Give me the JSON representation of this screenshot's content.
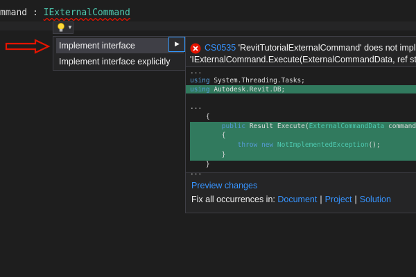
{
  "editor": {
    "code_prefix": "mmand : ",
    "interface_name": "IExternalCommand"
  },
  "quick_actions": {
    "items": [
      {
        "label": "Implement interface"
      },
      {
        "label": "Implement interface explicitly"
      }
    ]
  },
  "preview": {
    "error_code": "CS0535",
    "error_text_line1": " 'RevitTutorialExternalCommand' does not implem",
    "error_text_line2": "'IExternalCommand.Execute(ExternalCommandData, ref string,",
    "code_lines": {
      "l1": "...",
      "l2_kw": "using",
      "l2_rest": " System.Threading.Tasks;",
      "l3_kw": "using",
      "l3_rest": " Autodesk.Revit.DB;",
      "l4": "...",
      "l5": "    {",
      "l6_kw1": "public",
      "l6_mid": " Result Execute(",
      "l6_type": "ExternalCommandData",
      "l6_rest": " commandDat",
      "l7": "        {",
      "l8_kw1": "throw",
      "l8_kw2": "new",
      "l8_type": "NotImplementedException",
      "l8_rest": "();",
      "l9": "        }",
      "l10": "    }",
      "l11": "..."
    },
    "preview_changes_label": "Preview changes",
    "fix_label": "Fix all occurrences in:",
    "fix_document": "Document",
    "fix_project": "Project",
    "fix_solution": "Solution",
    "separator": "|"
  },
  "colors": {
    "accent_link": "#3794ff",
    "highlight_added": "#317a5e",
    "error_red": "#e51400"
  }
}
